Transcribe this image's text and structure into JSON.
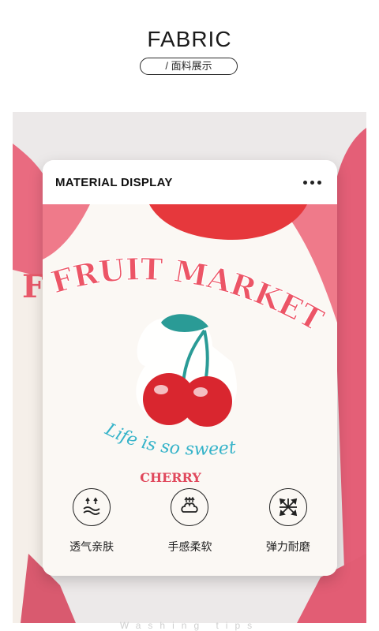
{
  "header": {
    "title": "FABRIC",
    "subtitle": "/ 面料展示"
  },
  "card": {
    "title": "MATERIAL DISPLAY",
    "menu_icon": "more-dots-icon",
    "print": {
      "headline": "FRUIT MARKET",
      "script_line": "Life is so sweet",
      "brand": "CHERRY"
    },
    "features": [
      {
        "label": "透气亲肤",
        "icon": "breathable-icon"
      },
      {
        "label": "手感柔软",
        "icon": "soft-touch-icon"
      },
      {
        "label": "弹力耐磨",
        "icon": "elastic-icon"
      }
    ]
  },
  "footer": {
    "hint": "Washing tips"
  },
  "colors": {
    "sleeve": "#e8677c",
    "collar": "#e83a3e",
    "cherry": "#d9262f",
    "leaf": "#2a9b96",
    "script": "#35b3c9"
  }
}
